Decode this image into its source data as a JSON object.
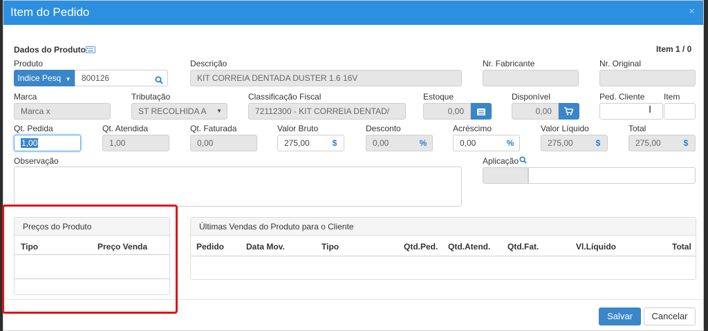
{
  "modal": {
    "title": "Item do Pedido",
    "close": "×"
  },
  "section": {
    "title": "Dados do Produto",
    "item_counter": "Item 1 / 0"
  },
  "produto": {
    "label": "Produto",
    "search_mode": "Indice Pesq",
    "code": "800126"
  },
  "descricao": {
    "label": "Descrição",
    "value": "KIT CORREIA DENTADA DUSTER 1.6 16V"
  },
  "nr_fabricante": {
    "label": "Nr. Fabricante",
    "value": ""
  },
  "nr_original": {
    "label": "Nr. Original",
    "value": ""
  },
  "marca": {
    "label": "Marca",
    "placeholder": "Marca x"
  },
  "tributacao": {
    "label": "Tributação",
    "value": "ST RECOLHIDA A"
  },
  "classificacao_fiscal": {
    "label": "Classificação Fiscal",
    "value": "72112300 - KIT CORREIA DENTAD/"
  },
  "estoque": {
    "label": "Estoque",
    "value": "0,00"
  },
  "disponivel": {
    "label": "Disponível",
    "value": "0,00"
  },
  "ped_cliente": {
    "label": "Ped. Cliente",
    "value": ""
  },
  "item": {
    "label": "Item",
    "value": ""
  },
  "qt_pedida": {
    "label": "Qt. Pedida",
    "value": "1,00"
  },
  "qt_atendida": {
    "label": "Qt. Atendida",
    "value": "1,00"
  },
  "qt_faturada": {
    "label": "Qt. Faturada",
    "value": "0,00"
  },
  "valor_bruto": {
    "label": "Valor Bruto",
    "value": "275,00",
    "suffix": "$"
  },
  "desconto": {
    "label": "Desconto",
    "value": "0,00",
    "suffix": "%"
  },
  "acrescimo": {
    "label": "Acréscimo",
    "value": "0,00",
    "suffix": "%"
  },
  "valor_liquido": {
    "label": "Valor Líquido",
    "value": "275,00",
    "suffix": "$"
  },
  "total": {
    "label": "Total",
    "value": "275,00",
    "suffix": "$"
  },
  "observacao": {
    "label": "Observação",
    "value": ""
  },
  "aplicacao": {
    "label": "Aplicação"
  },
  "precos_panel": {
    "title": "Preços do Produto",
    "columns": [
      "Tipo",
      "Preço Venda"
    ]
  },
  "vendas_panel": {
    "title": "Últimas Vendas do Produto para o Cliente",
    "columns": [
      "Pedido",
      "Data Mov.",
      "Tipo",
      "Qtd.Ped.",
      "Qtd.Atend.",
      "Qtd.Fat.",
      "Vl.Líquido",
      "Total"
    ]
  },
  "footer": {
    "save": "Salvar",
    "cancel": "Cancelar"
  },
  "colors": {
    "header": "#2c8fe0",
    "primary_button": "#3a86c8",
    "annotation": "#e01515"
  }
}
